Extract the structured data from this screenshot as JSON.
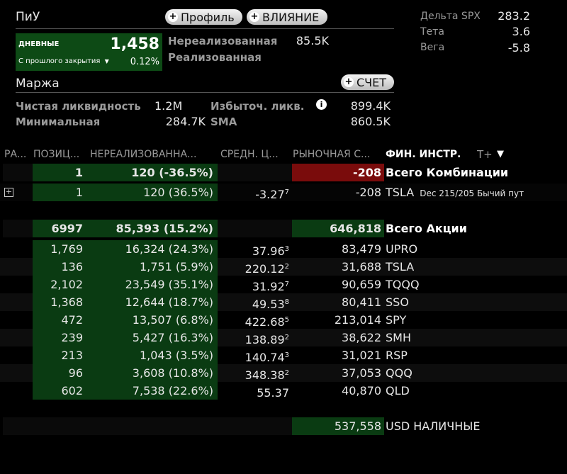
{
  "pnl": {
    "title": "ПиУ",
    "profile_btn": "Профиль",
    "impact_btn": "ВЛИЯНИЕ",
    "daily_label": "ДНЕВНЫЕ",
    "daily_value": "1,458",
    "since_close_label": "С прошлого закрытия",
    "since_close_pct": "0.12%",
    "unrealized_label": "Нереализованная",
    "unrealized_value": "85.5K",
    "realized_label": "Реализованная"
  },
  "greeks": [
    {
      "label": "Дельта SPX",
      "value": "283.2"
    },
    {
      "label": "Тета",
      "value": "3.6"
    },
    {
      "label": "Вега",
      "value": "-5.8"
    }
  ],
  "margin": {
    "title": "Маржа",
    "account_btn": "СЧЕТ",
    "net_liq_label": "Чистая ликвидность",
    "net_liq_value": "1.2M",
    "excess_liq_label": "Избыточ. ликв.",
    "excess_liq_value": "899.4K",
    "minimum_label": "Минимальная",
    "minimum_value": "284.7K",
    "sma_label": "SMA",
    "sma_value": "860.5K"
  },
  "table": {
    "headers": [
      "РА...",
      "ПОЗИЦ...",
      "НЕРЕАЛИЗОВАННА...",
      "СРЕДН. Ц...",
      "РЫНОЧНАЯ С...",
      "ФИН. ИНСТР.",
      "T+"
    ],
    "combo_total": {
      "pos": "1",
      "unreal": "120 (-36.5%)",
      "market": "-208",
      "name": "Всего Комбинации"
    },
    "combo_row": {
      "pos": "1",
      "unreal": "120 (36.5%)",
      "avg": "-3.27",
      "avg_sup": "7",
      "market": "-208",
      "name": "TSLA",
      "detail": "Dec 215/205 Бычий пут"
    },
    "stocks_total": {
      "pos": "6997",
      "unreal": "85,393 (15.2%)",
      "market": "646,818",
      "name": "Всего Акции"
    },
    "stocks": [
      {
        "pos": "1,769",
        "unreal": "16,324 (24.3%)",
        "avg": "37.96",
        "sup": "3",
        "market": "83,479",
        "name": "UPRO"
      },
      {
        "pos": "136",
        "unreal": "1,751 (5.9%)",
        "avg": "220.12",
        "sup": "2",
        "market": "31,688",
        "name": "TSLA"
      },
      {
        "pos": "2,102",
        "unreal": "23,549 (35.1%)",
        "avg": "31.92",
        "sup": "7",
        "market": "90,659",
        "name": "TQQQ"
      },
      {
        "pos": "1,368",
        "unreal": "12,644 (18.7%)",
        "avg": "49.53",
        "sup": "8",
        "market": "80,411",
        "name": "SSO"
      },
      {
        "pos": "472",
        "unreal": "13,507 (6.8%)",
        "avg": "422.68",
        "sup": "5",
        "market": "213,014",
        "name": "SPY"
      },
      {
        "pos": "239",
        "unreal": "5,427 (16.3%)",
        "avg": "138.89",
        "sup": "2",
        "market": "38,622",
        "name": "SMH"
      },
      {
        "pos": "213",
        "unreal": "1,043 (3.5%)",
        "avg": "140.74",
        "sup": "3",
        "market": "31,021",
        "name": "RSP"
      },
      {
        "pos": "96",
        "unreal": "3,608 (10.8%)",
        "avg": "348.38",
        "sup": "2",
        "market": "37,053",
        "name": "QQQ"
      },
      {
        "pos": "602",
        "unreal": "7,538 (22.6%)",
        "avg": "55.37",
        "sup": "",
        "market": "40,870",
        "name": "QLD"
      }
    ],
    "cash": {
      "market": "537,558",
      "name": "USD НАЛИЧНЫЕ"
    }
  }
}
